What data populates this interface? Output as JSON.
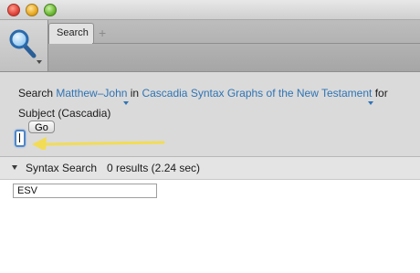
{
  "window": {
    "tabs": [
      {
        "label": "Search"
      }
    ],
    "add_tab_label": "+"
  },
  "query": {
    "prefix": "Search",
    "range_link": "Matthew–John",
    "in_label": "in",
    "resource_link": "Cascadia Syntax Graphs of the New Testament",
    "for_label": "for",
    "subject": "Subject (Cascadia)",
    "go_label": "Go",
    "input_value": ""
  },
  "results": {
    "section_label": "Syntax Search",
    "count_text": "0 results (2.24 sec)",
    "version_value": "ESV"
  },
  "colors": {
    "link": "#2f74b4",
    "arrow": "#f2dc55",
    "focus_ring": "#4f86c7"
  },
  "icons": [
    "magnifier-icon",
    "caret-down-icon",
    "disclosure-triangle-icon"
  ]
}
